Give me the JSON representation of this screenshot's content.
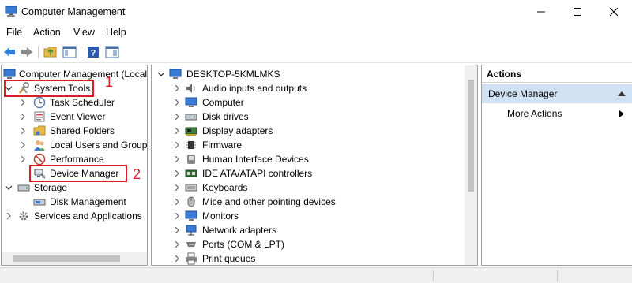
{
  "window": {
    "title": "Computer Management"
  },
  "menu": [
    "File",
    "Action",
    "View",
    "Help"
  ],
  "left_tree": {
    "root": "Computer Management (Local",
    "system_tools": "System Tools",
    "system_tools_children": [
      "Task Scheduler",
      "Event Viewer",
      "Shared Folders",
      "Local Users and Groups",
      "Performance",
      "Device Manager"
    ],
    "storage": "Storage",
    "storage_children": [
      "Disk Management"
    ],
    "services": "Services and Applications"
  },
  "annotations": {
    "one": "1",
    "two": "2"
  },
  "device_tree": {
    "root": "DESKTOP-5KMLMKS",
    "categories": [
      {
        "label": "Audio inputs and outputs",
        "icon": "speaker-icon"
      },
      {
        "label": "Computer",
        "icon": "monitor-icon"
      },
      {
        "label": "Disk drives",
        "icon": "disk-drive-icon"
      },
      {
        "label": "Display adapters",
        "icon": "display-adapter-icon"
      },
      {
        "label": "Firmware",
        "icon": "chip-icon"
      },
      {
        "label": "Human Interface Devices",
        "icon": "hid-icon"
      },
      {
        "label": "IDE ATA/ATAPI controllers",
        "icon": "ide-controller-icon"
      },
      {
        "label": "Keyboards",
        "icon": "keyboard-icon"
      },
      {
        "label": "Mice and other pointing devices",
        "icon": "mouse-icon"
      },
      {
        "label": "Monitors",
        "icon": "monitor-icon"
      },
      {
        "label": "Network adapters",
        "icon": "network-icon"
      },
      {
        "label": "Ports (COM & LPT)",
        "icon": "port-icon"
      },
      {
        "label": "Print queues",
        "icon": "printer-icon"
      }
    ]
  },
  "actions": {
    "header": "Actions",
    "section": "Device Manager",
    "more": "More Actions"
  },
  "colors": {
    "annotation_red": "#d61f26",
    "selected_section": "#cfe1f3"
  }
}
